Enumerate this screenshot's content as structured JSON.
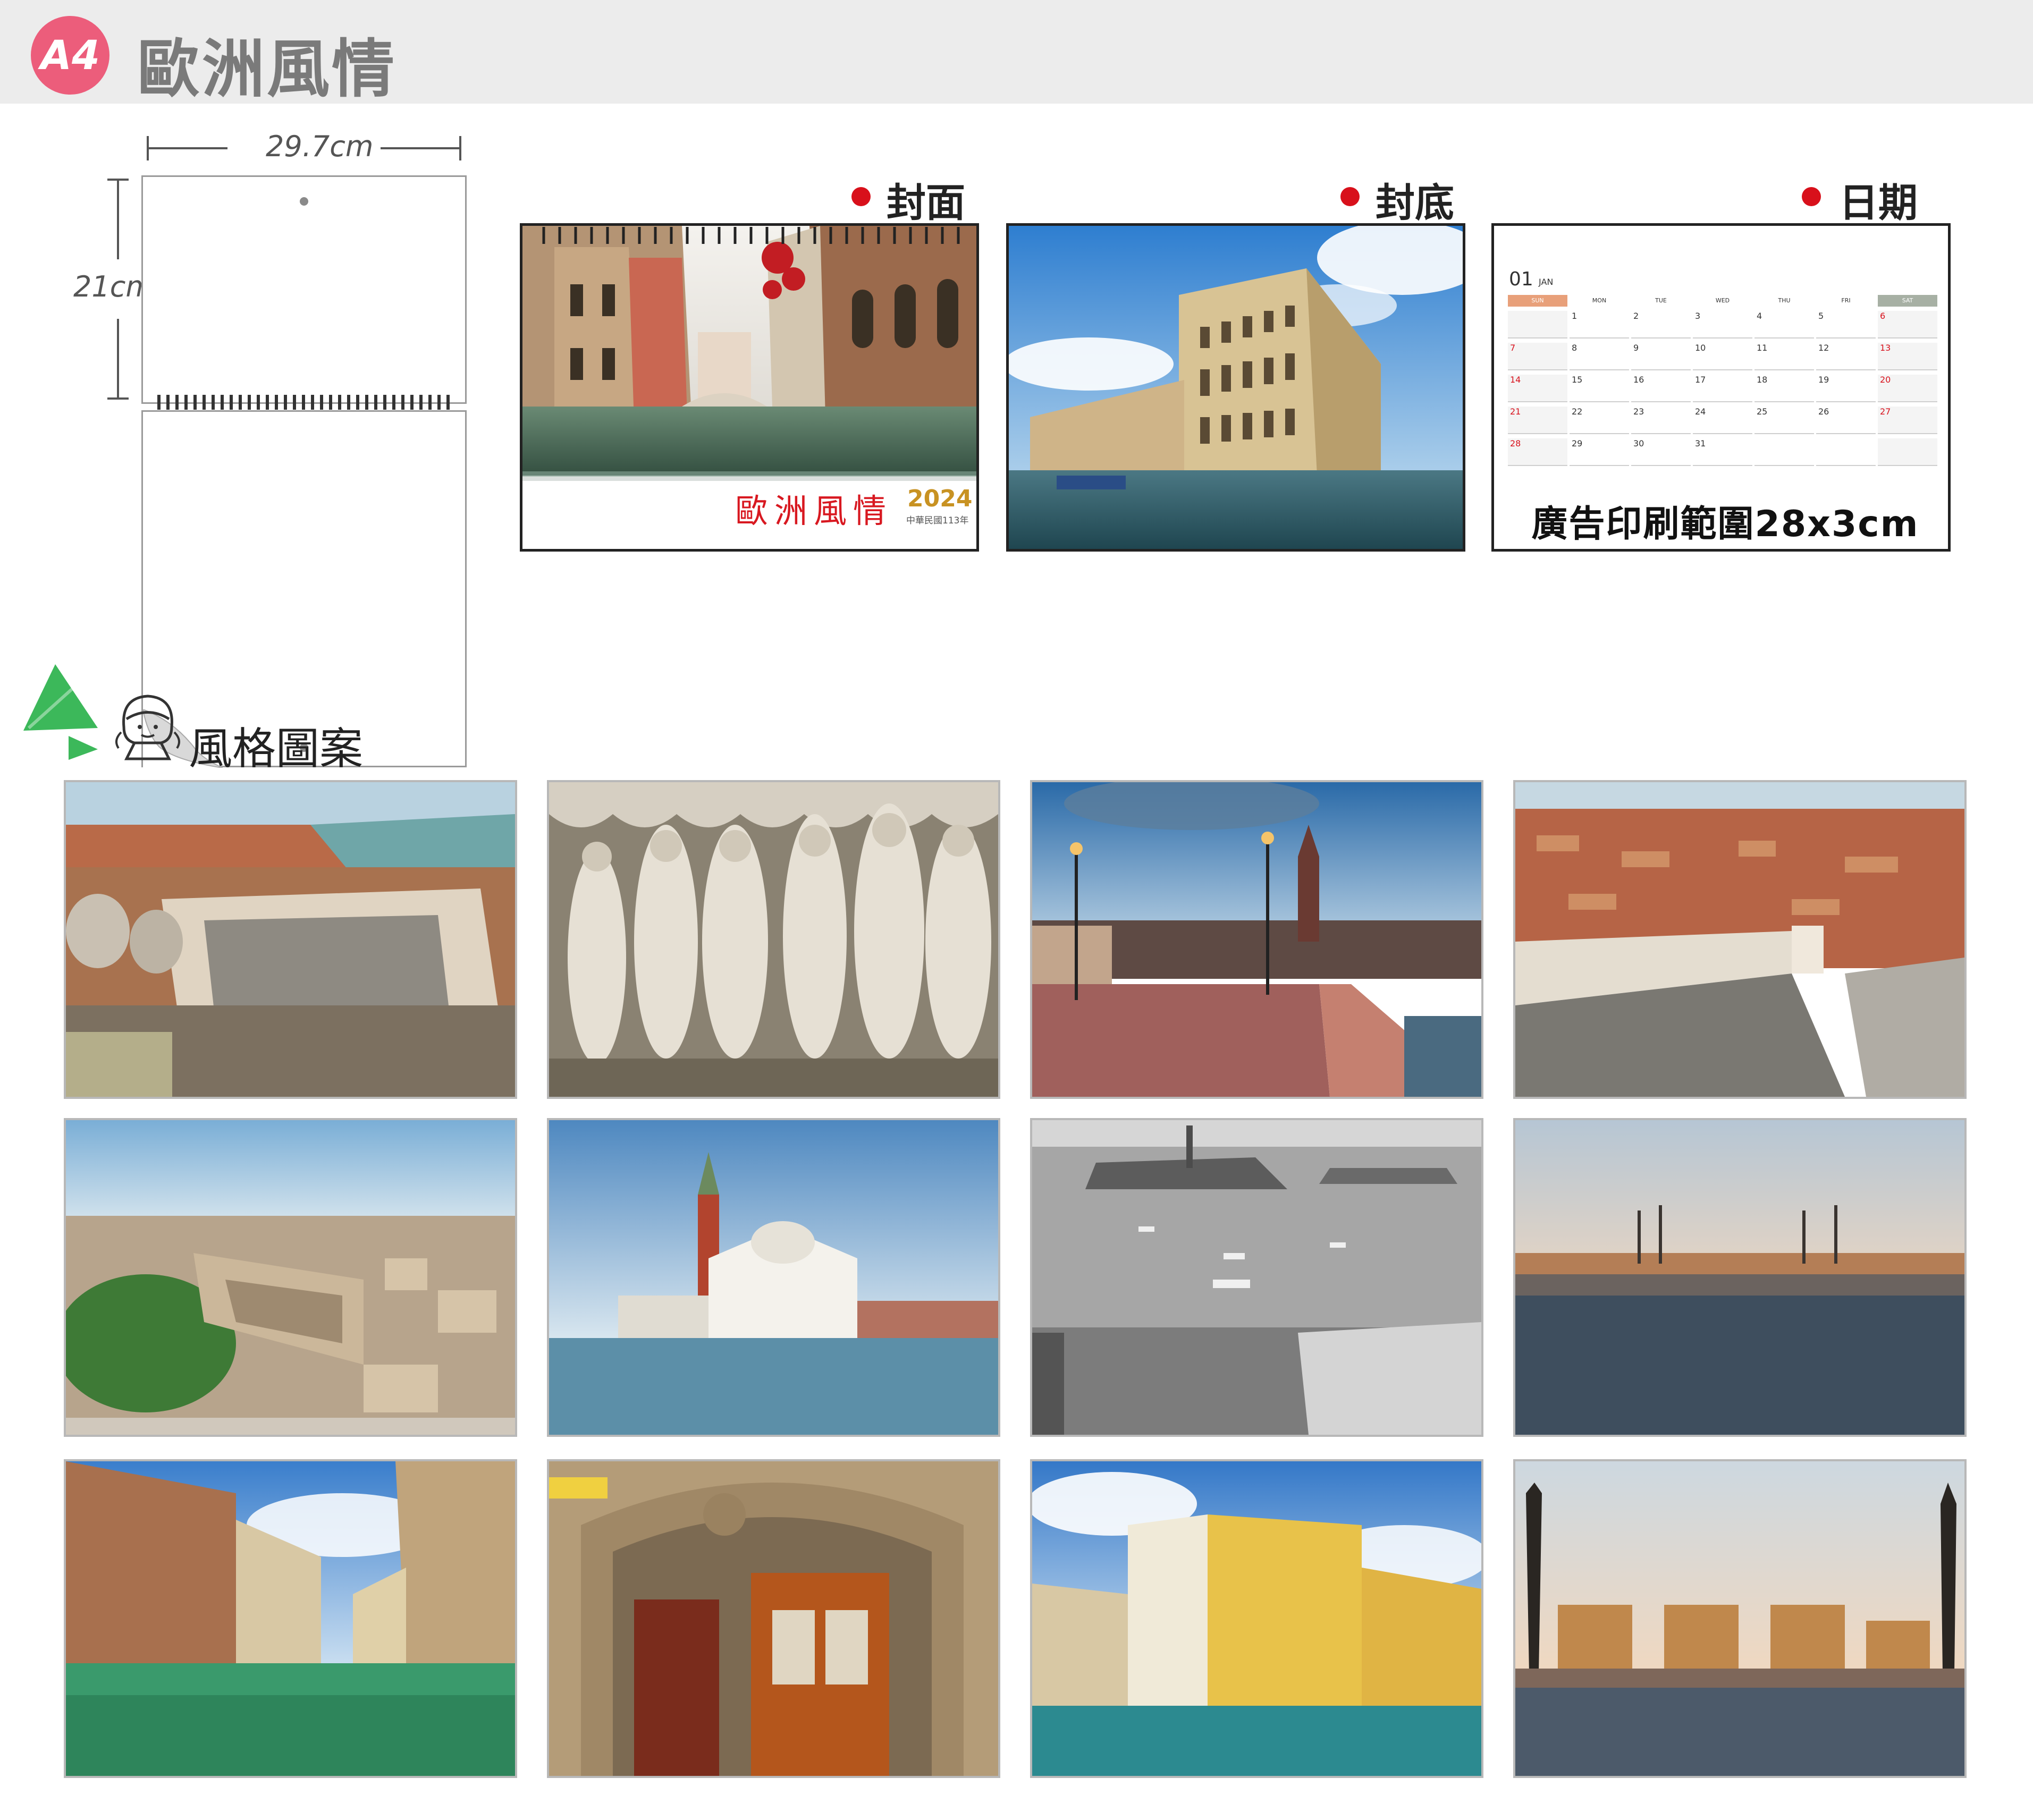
{
  "header": {
    "badge": "A4",
    "title": "歐洲風情"
  },
  "size": {
    "width": "29.7cm",
    "height": "21cm"
  },
  "preview": {
    "cover_label": "封面",
    "back_label": "封底",
    "date_label": "日期",
    "cover_title": "歐洲風情",
    "cover_year": "2024",
    "cover_subtitle": "中華民國113年"
  },
  "calendar": {
    "month_num": "01",
    "month_name": "JAN",
    "weekdays": [
      "SUN",
      "MON",
      "TUE",
      "WED",
      "THU",
      "FRI",
      "SAT"
    ],
    "weeks": [
      [
        "",
        "1",
        "2",
        "3",
        "4",
        "5",
        "6"
      ],
      [
        "7",
        "8",
        "9",
        "10",
        "11",
        "12",
        "13"
      ],
      [
        "14",
        "15",
        "16",
        "17",
        "18",
        "19",
        "20"
      ],
      [
        "21",
        "22",
        "23",
        "24",
        "25",
        "26",
        "27"
      ],
      [
        "28",
        "29",
        "30",
        "31",
        "",
        "",
        ""
      ]
    ],
    "ad_text": "廣告印刷範圍28x3cm"
  },
  "styles": {
    "label": "風格圖案"
  },
  "colors": {
    "badge": "#ec5d7b",
    "sun_header": "#e8a07a",
    "sat_header": "#a7b0a4",
    "holiday_red": "#d8101b"
  }
}
